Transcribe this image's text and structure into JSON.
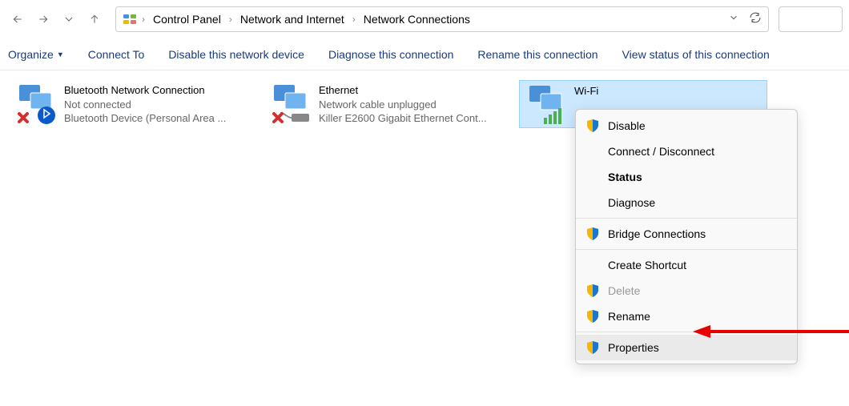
{
  "breadcrumbs": [
    "Control Panel",
    "Network and Internet",
    "Network Connections"
  ],
  "toolbar": {
    "organize": "Organize",
    "connect_to": "Connect To",
    "disable": "Disable this network device",
    "diagnose": "Diagnose this connection",
    "rename": "Rename this connection",
    "view_status": "View status of this connection"
  },
  "connections": [
    {
      "name": "Bluetooth Network Connection",
      "status": "Not connected",
      "device": "Bluetooth Device (Personal Area ..."
    },
    {
      "name": "Ethernet",
      "status": "Network cable unplugged",
      "device": "Killer E2600 Gigabit Ethernet Cont..."
    },
    {
      "name": "Wi-Fi",
      "status": "",
      "device": ""
    }
  ],
  "context_menu": {
    "disable": "Disable",
    "connect_disconnect": "Connect / Disconnect",
    "status": "Status",
    "diagnose": "Diagnose",
    "bridge": "Bridge Connections",
    "shortcut": "Create Shortcut",
    "delete": "Delete",
    "rename": "Rename",
    "properties": "Properties"
  }
}
